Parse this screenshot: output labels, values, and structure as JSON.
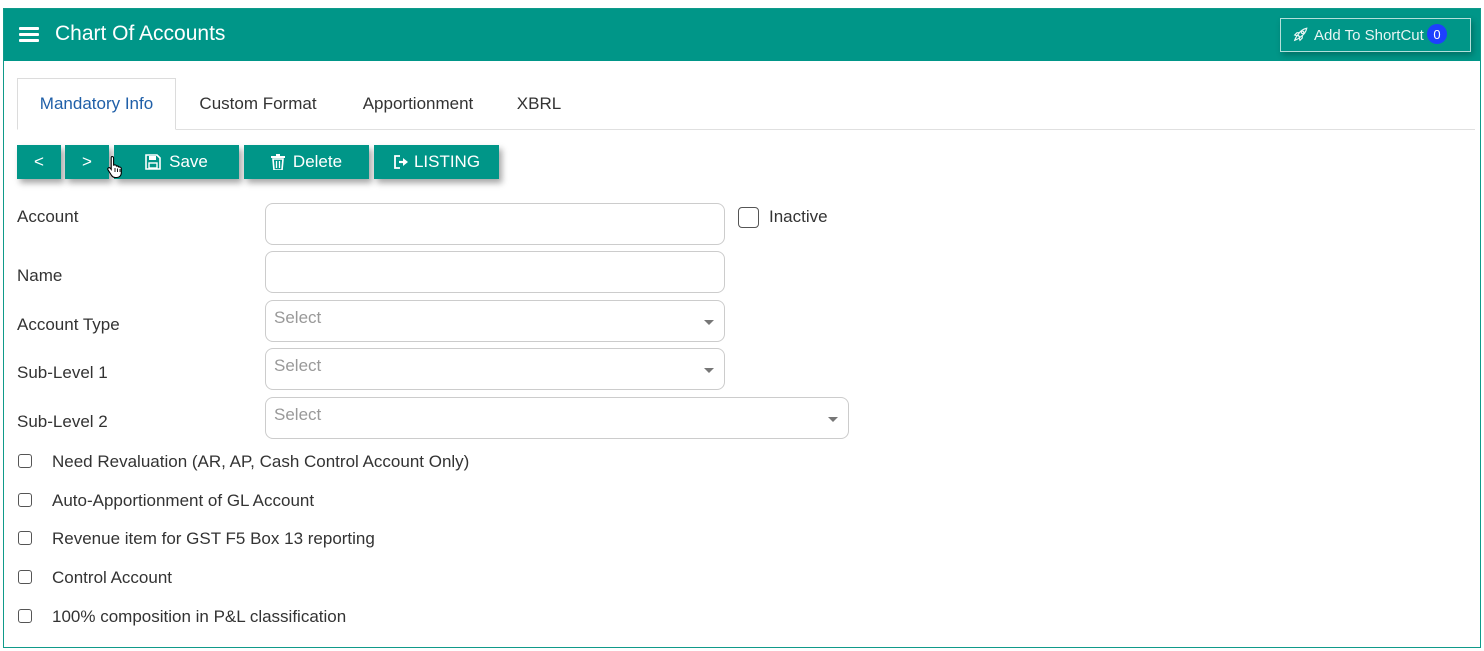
{
  "header": {
    "title": "Chart Of Accounts",
    "menu_icon": "hamburger-icon",
    "shortcut_label": "Add To ShortCut",
    "shortcut_icon": "rocket-icon",
    "shortcut_badge": "0"
  },
  "tabs": [
    {
      "label": "Mandatory Info",
      "active": true
    },
    {
      "label": "Custom Format",
      "active": false
    },
    {
      "label": "Apportionment",
      "active": false
    },
    {
      "label": "XBRL",
      "active": false
    }
  ],
  "toolbar": {
    "prev_label": "<",
    "next_label": ">",
    "save_label": "Save",
    "save_icon": "floppy-disk-icon",
    "delete_label": "Delete",
    "delete_icon": "trash-icon",
    "listing_label": "LISTING",
    "listing_icon": "sign-out-icon"
  },
  "form": {
    "account_label": "Account",
    "account_value": "",
    "inactive_label": "Inactive",
    "inactive_checked": false,
    "name_label": "Name",
    "name_value": "",
    "account_type_label": "Account Type",
    "account_type_value": "Select",
    "sublevel1_label": "Sub-Level 1",
    "sublevel1_value": "Select",
    "sublevel2_label": "Sub-Level 2",
    "sublevel2_value": "Select"
  },
  "checkboxes": [
    {
      "label": "Need Revaluation (AR, AP, Cash Control Account Only)",
      "checked": false
    },
    {
      "label": "Auto-Apportionment of GL Account",
      "checked": false
    },
    {
      "label": "Revenue item for GST F5 Box 13 reporting",
      "checked": false
    },
    {
      "label": "Control Account",
      "checked": false
    },
    {
      "label": "100% composition in P&L classification",
      "checked": false
    }
  ],
  "colors": {
    "brand": "#009688",
    "active_tab_text": "#1f5fa8",
    "badge": "#1e40ff"
  }
}
